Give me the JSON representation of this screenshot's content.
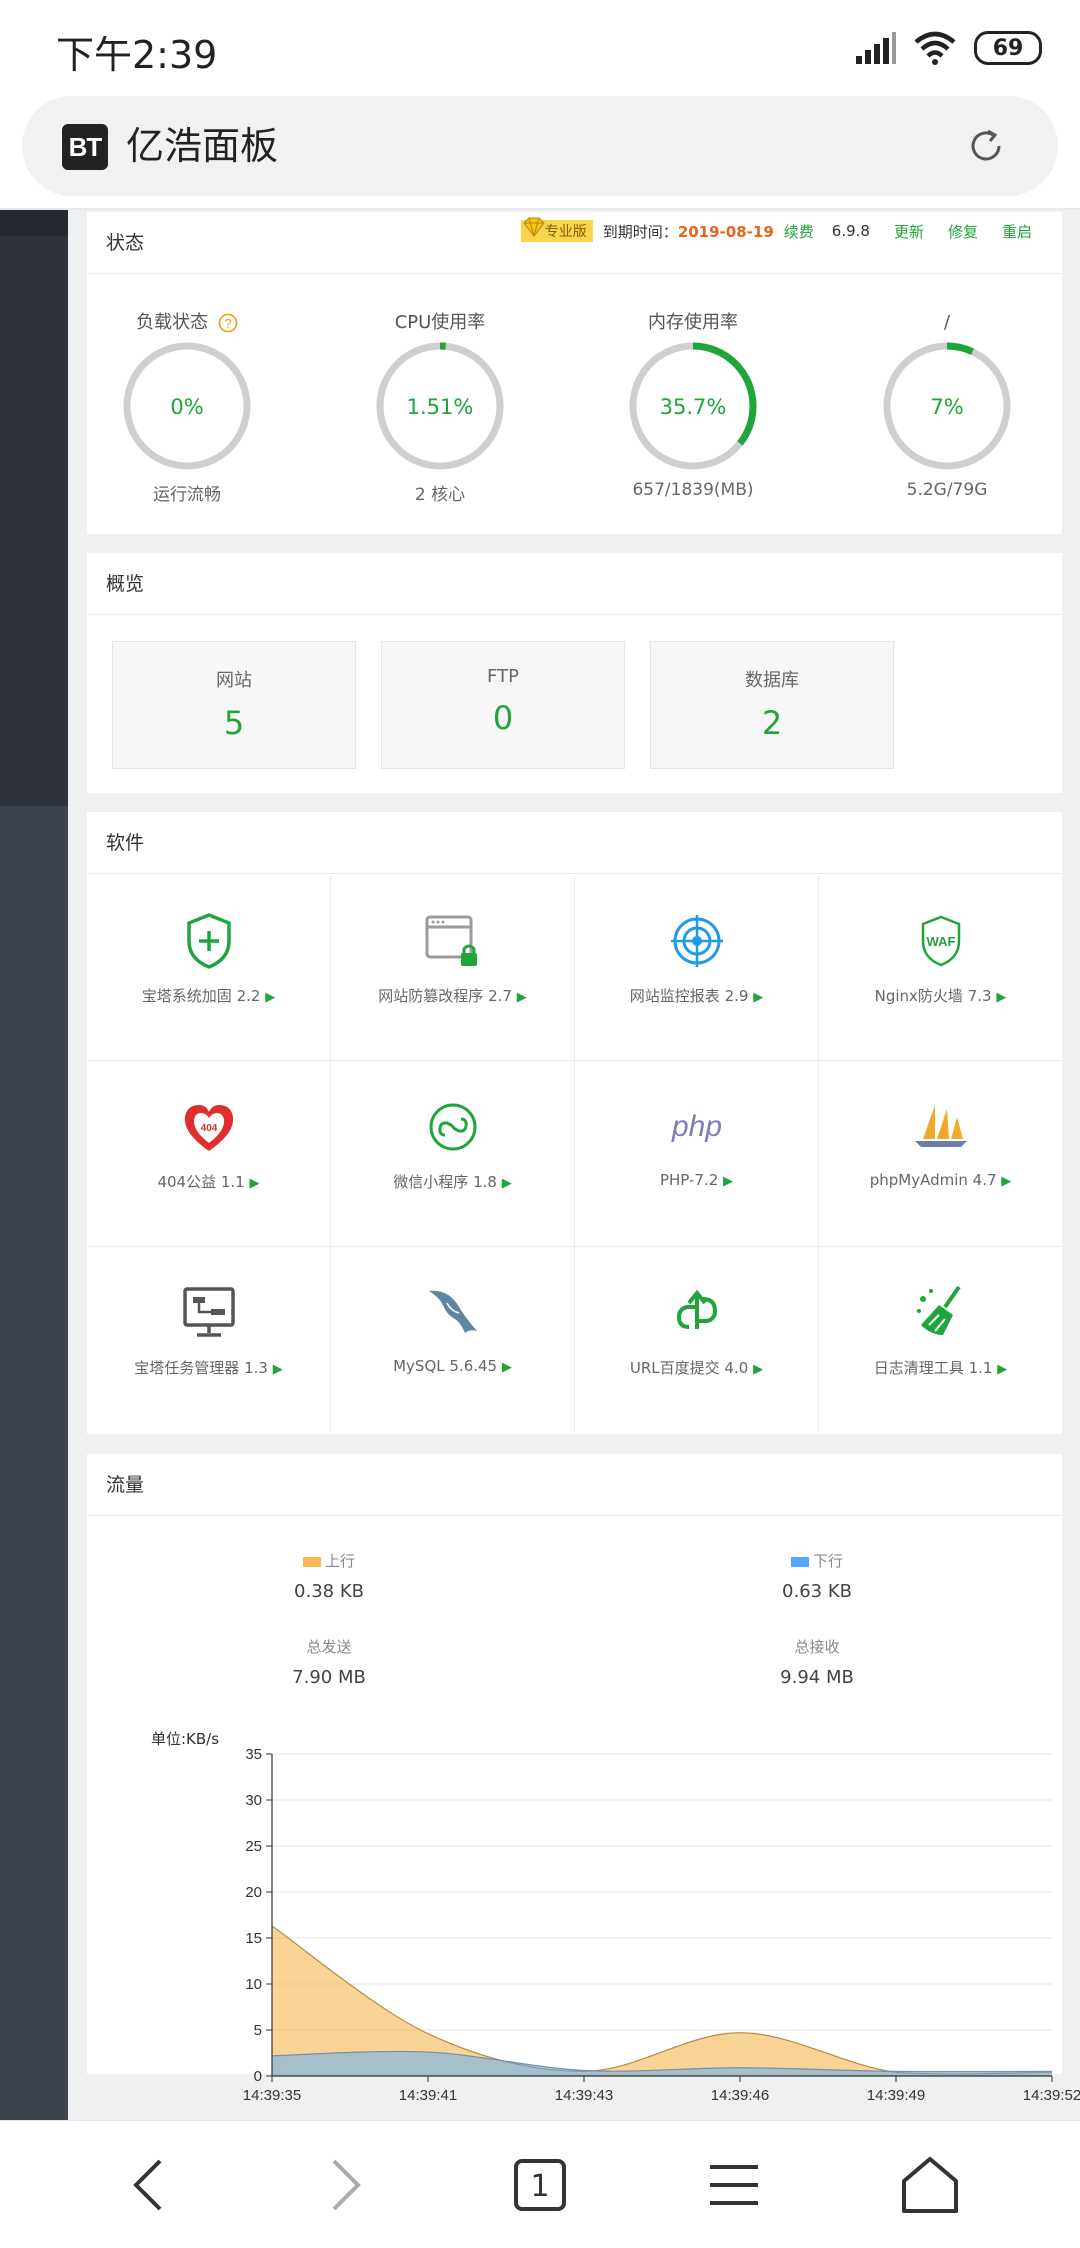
{
  "status_bar": {
    "time": "下午2:39",
    "battery": "69"
  },
  "browser": {
    "title": "亿浩面板",
    "logo": "BT"
  },
  "status_panel": {
    "title": "状态",
    "vip_label": "专业版",
    "expire_label": "到期时间：",
    "expire_date": "2019-08-19",
    "renew": "续费",
    "version": "6.9.8",
    "update": "更新",
    "repair": "修复",
    "restart": "重启",
    "gauges": [
      {
        "label": "负载状态",
        "value": "0%",
        "sub": "运行流畅",
        "percent": 0
      },
      {
        "label": "CPU使用率",
        "value": "1.51%",
        "sub": "2 核心",
        "percent": 1.51
      },
      {
        "label": "内存使用率",
        "value": "35.7%",
        "sub": "657/1839(MB)",
        "percent": 35.7
      },
      {
        "label": "/",
        "value": "7%",
        "sub": "5.2G/79G",
        "percent": 7
      }
    ]
  },
  "overview": {
    "title": "概览",
    "cards": [
      {
        "label": "网站",
        "value": "5"
      },
      {
        "label": "FTP",
        "value": "0"
      },
      {
        "label": "数据库",
        "value": "2"
      }
    ]
  },
  "software": {
    "title": "软件",
    "items": [
      {
        "name": "宝塔系统加固 2.2",
        "icon": "shield-plus-icon"
      },
      {
        "name": "网站防篡改程序 2.7",
        "icon": "window-lock-icon"
      },
      {
        "name": "网站监控报表 2.9",
        "icon": "radar-icon"
      },
      {
        "name": "Nginx防火墙 7.3",
        "icon": "waf-shield-icon"
      },
      {
        "name": "404公益 1.1",
        "icon": "heart-404-icon"
      },
      {
        "name": "微信小程序 1.8",
        "icon": "mini-program-icon"
      },
      {
        "name": "PHP-7.2",
        "icon": "php-icon"
      },
      {
        "name": "phpMyAdmin 4.7",
        "icon": "sailboat-icon"
      },
      {
        "name": "宝塔任务管理器 1.3",
        "icon": "monitor-task-icon"
      },
      {
        "name": "MySQL 5.6.45",
        "icon": "dolphin-icon"
      },
      {
        "name": "URL百度提交 4.0",
        "icon": "link-submit-icon"
      },
      {
        "name": "日志清理工具 1.1",
        "icon": "broom-icon"
      }
    ],
    "arrow": "▶"
  },
  "traffic": {
    "title": "流量",
    "up_label": "上行",
    "up_value": "0.38 KB",
    "down_label": "下行",
    "down_value": "0.63 KB",
    "sent_label": "总发送",
    "sent_value": "7.90 MB",
    "recv_label": "总接收",
    "recv_value": "9.94 MB",
    "colors": {
      "up": "#f7b851",
      "down": "#52a9ff"
    }
  },
  "chart_data": {
    "type": "area",
    "ylabel": "单位:KB/s",
    "x": [
      "14:39:35",
      "14:39:41",
      "14:39:43",
      "14:39:46",
      "14:39:49",
      "14:39:52"
    ],
    "series": [
      {
        "name": "上行",
        "values": [
          16.3,
          4.6,
          0.5,
          4.7,
          0.4,
          0.4
        ]
      },
      {
        "name": "下行",
        "values": [
          2.2,
          2.6,
          0.6,
          0.9,
          0.5,
          0.5
        ]
      }
    ],
    "ylim": [
      0,
      35
    ],
    "yticks": [
      0,
      5,
      10,
      15,
      20,
      25,
      30,
      35
    ],
    "grid": true
  }
}
